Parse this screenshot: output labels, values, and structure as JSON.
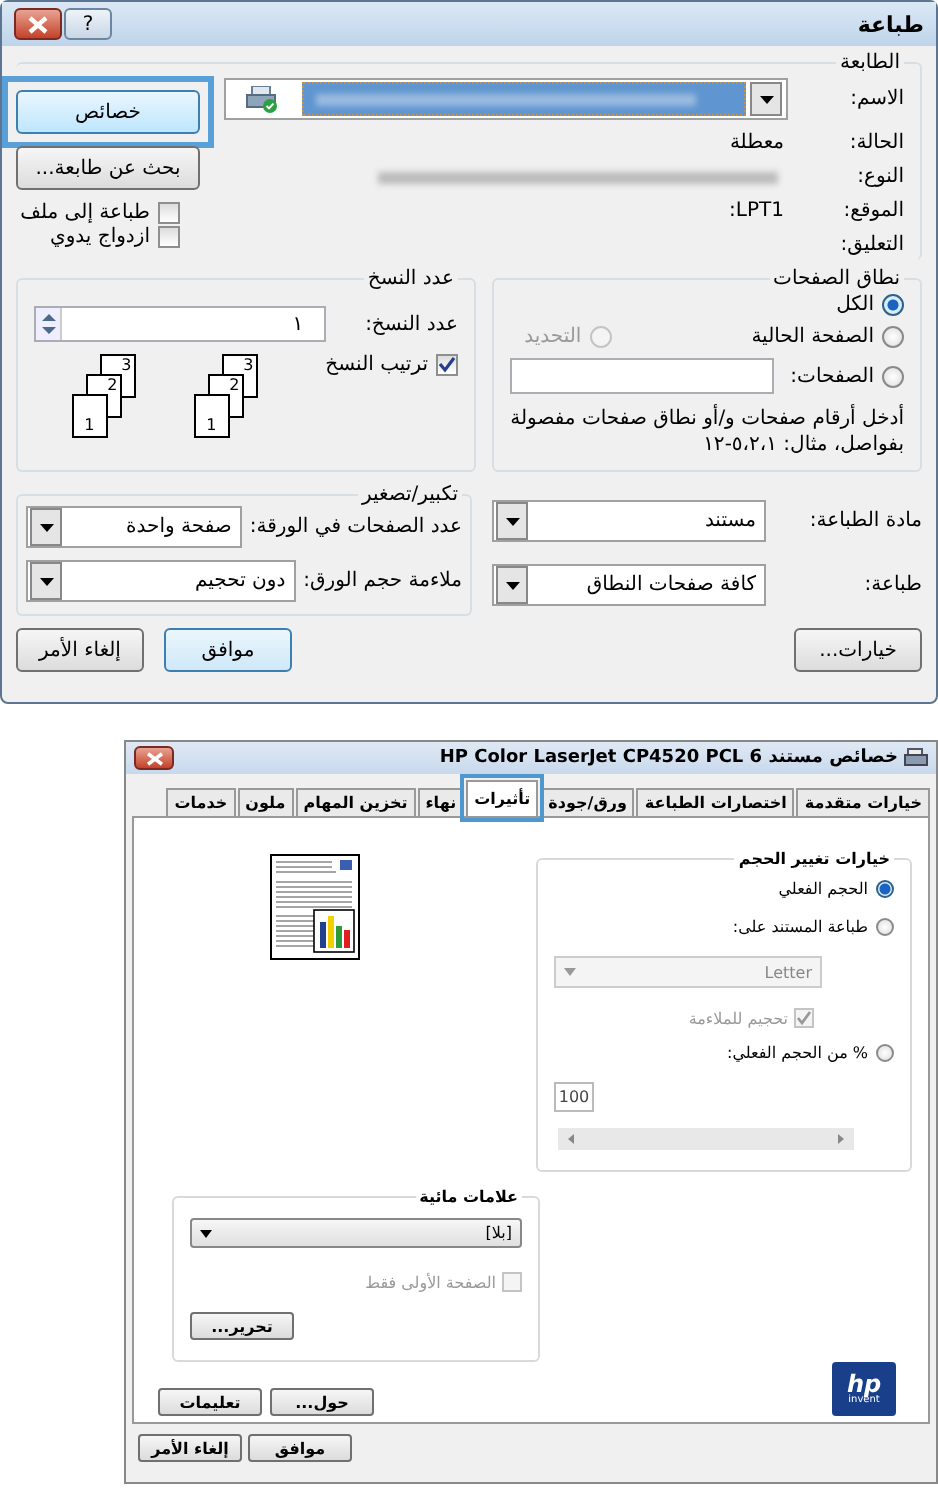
{
  "print_dialog": {
    "title": "طباعة",
    "help_button": "?",
    "printer": {
      "legend": "الطابعة",
      "name_label": "الاسم:",
      "properties_button": {
        "label": "خصائص",
        "callout": true
      },
      "find_button": "بحث عن طابعة...",
      "info": [
        {
          "label": "الحالة:",
          "value": "معطلة"
        },
        {
          "label": "النوع:",
          "blurred": true
        },
        {
          "label": "الموقع:",
          "value": "LPT1:"
        },
        {
          "label": "التعليق:"
        }
      ],
      "options": [
        {
          "label": "طباعة إلى ملف",
          "checked": false
        },
        {
          "label": "ازدواج يدوي",
          "checked": false
        }
      ]
    },
    "page_range": {
      "legend": "نطاق الصفحات",
      "all": {
        "label": "الكل",
        "selected": true
      },
      "current": {
        "label": "الصفحة الحالية",
        "selected": false
      },
      "selection": {
        "label": "التحديد",
        "selected": false,
        "disabled": true
      },
      "pages": {
        "label": "الصفحات:",
        "selected": false
      },
      "hint": "أدخل أرقام صفحات و/أو نطاق صفحات مفصولة بفواصل، مثال: ٥،٢،١-١٢"
    },
    "copies": {
      "legend": "عدد النسخ",
      "label": "عدد النسخ:",
      "value": "١",
      "stacks": [
        [
          "3",
          "2",
          "1"
        ],
        [
          "3",
          "2",
          "1"
        ]
      ],
      "collate": {
        "label": "ترتيب النسخ",
        "checked": true
      }
    },
    "print_what": [
      {
        "label": "مادة الطباعة:",
        "value": "مستند"
      },
      {
        "label": "طباعة:",
        "value": "كافة صفحات النطاق"
      }
    ],
    "zoom": {
      "legend": "تكبير/تصغير",
      "fields": [
        {
          "label": "عدد الصفحات في الورقة:",
          "value": "صفحة واحدة"
        },
        {
          "label": "ملاءمة حجم الورق:",
          "value": "دون تحجيم"
        }
      ]
    },
    "options_button": "خيارات...",
    "ok_button": "موافق",
    "cancel_button": "إلغاء الأمر"
  },
  "properties_dialog": {
    "title": "خصائص مستند HP Color LaserJet CP4520 PCL 6",
    "tabs": [
      {
        "label": "خيارات متقدمة",
        "selected": false,
        "callout": false
      },
      {
        "label": "اختصارات الطباعة",
        "selected": false,
        "callout": false
      },
      {
        "label": "ورق/جودة",
        "selected": false,
        "callout": false
      },
      {
        "label": "تأثيرات",
        "selected": true,
        "callout": true
      },
      {
        "label": "نهاء",
        "selected": false,
        "callout": false
      },
      {
        "label": "تخزين المهام",
        "selected": false,
        "callout": false
      },
      {
        "label": "ملون",
        "selected": false,
        "callout": false
      },
      {
        "label": "خدمات",
        "selected": false,
        "callout": false
      }
    ],
    "resize": {
      "legend": "خيارات تغيير الحجم",
      "actual": {
        "label": "الحجم الفعلي",
        "selected": true
      },
      "print_on": {
        "label": "طباعة المستند على:",
        "selected": false
      },
      "paper": "Letter",
      "fit": {
        "label": "تحجيم للملاءمة",
        "checked": true,
        "disabled": true
      },
      "percent": {
        "label": "% من الحجم الفعلي:",
        "selected": false
      },
      "percent_value": "100"
    },
    "watermarks": {
      "legend": "علامات مائية",
      "value": "[بلا]",
      "first_page": {
        "label": "الصفحة الأولى فقط",
        "checked": false,
        "disabled": true
      },
      "edit_button": "تحرير..."
    },
    "logo": {
      "mark": "hp",
      "tagline": "invent"
    },
    "about_button": "حول...",
    "help_button": "تعليمات",
    "ok_button": "موافق",
    "cancel_button": "إلغاء الأمر"
  }
}
